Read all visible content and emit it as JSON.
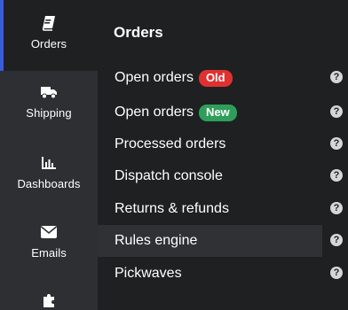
{
  "rail": {
    "items": [
      {
        "label": "Orders",
        "icon": "book-icon"
      },
      {
        "label": "Shipping",
        "icon": "truck-icon"
      },
      {
        "label": "Dashboards",
        "icon": "bar-chart-icon"
      },
      {
        "label": "Emails",
        "icon": "envelope-icon"
      },
      {
        "label": "",
        "icon": "puzzle-icon"
      }
    ]
  },
  "panel": {
    "title": "Orders",
    "items": [
      {
        "label": "Open orders",
        "badge": "Old",
        "badge_color": "#e03131"
      },
      {
        "label": "Open orders",
        "badge": "New",
        "badge_color": "#2f9e5a"
      },
      {
        "label": "Processed orders"
      },
      {
        "label": "Dispatch console"
      },
      {
        "label": "Returns & refunds"
      },
      {
        "label": "Rules engine"
      },
      {
        "label": "Pickwaves"
      }
    ],
    "help_glyph": "?"
  },
  "colors": {
    "rail_bg": "#2d2f32",
    "panel_bg": "#1f2022",
    "active_indicator": "#3b5bdb",
    "hover_row": "#2f3134"
  }
}
